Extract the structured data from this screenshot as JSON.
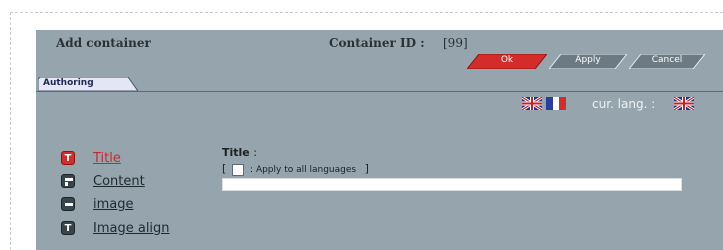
{
  "header": {
    "title": "Add container",
    "container_id_label": "Container ID :",
    "container_id_value": "[99]"
  },
  "buttons": {
    "ok": "Ok",
    "apply": "Apply",
    "cancel": "Cancel"
  },
  "tabs": [
    {
      "label": "Authoring",
      "active": true
    }
  ],
  "language": {
    "current_label": "cur. lang. :",
    "available_flags": [
      "uk-flag-icon",
      "fr-flag-icon"
    ],
    "current_flag": "uk-flag-icon"
  },
  "nav": {
    "items": [
      {
        "label": "Title",
        "icon": "T",
        "icon_name": "text-icon",
        "active": true
      },
      {
        "label": "Content",
        "icon": "",
        "icon_name": "content-icon",
        "active": false
      },
      {
        "label": "image",
        "icon": "",
        "icon_name": "image-icon",
        "active": false
      },
      {
        "label": "Image align",
        "icon": "T",
        "icon_name": "text-icon",
        "active": false
      }
    ]
  },
  "field": {
    "label": "Title",
    "label_suffix": " :",
    "apply_all_open": "[",
    "apply_all_text": ": Apply to all languages",
    "apply_all_close": "]",
    "apply_all_checked": false,
    "value": ""
  },
  "colors": {
    "panel": "#96a5ad",
    "accent_red": "#d42b2b",
    "button_grey": "#6c7a84",
    "tab_fill": "#e4e6f4"
  }
}
